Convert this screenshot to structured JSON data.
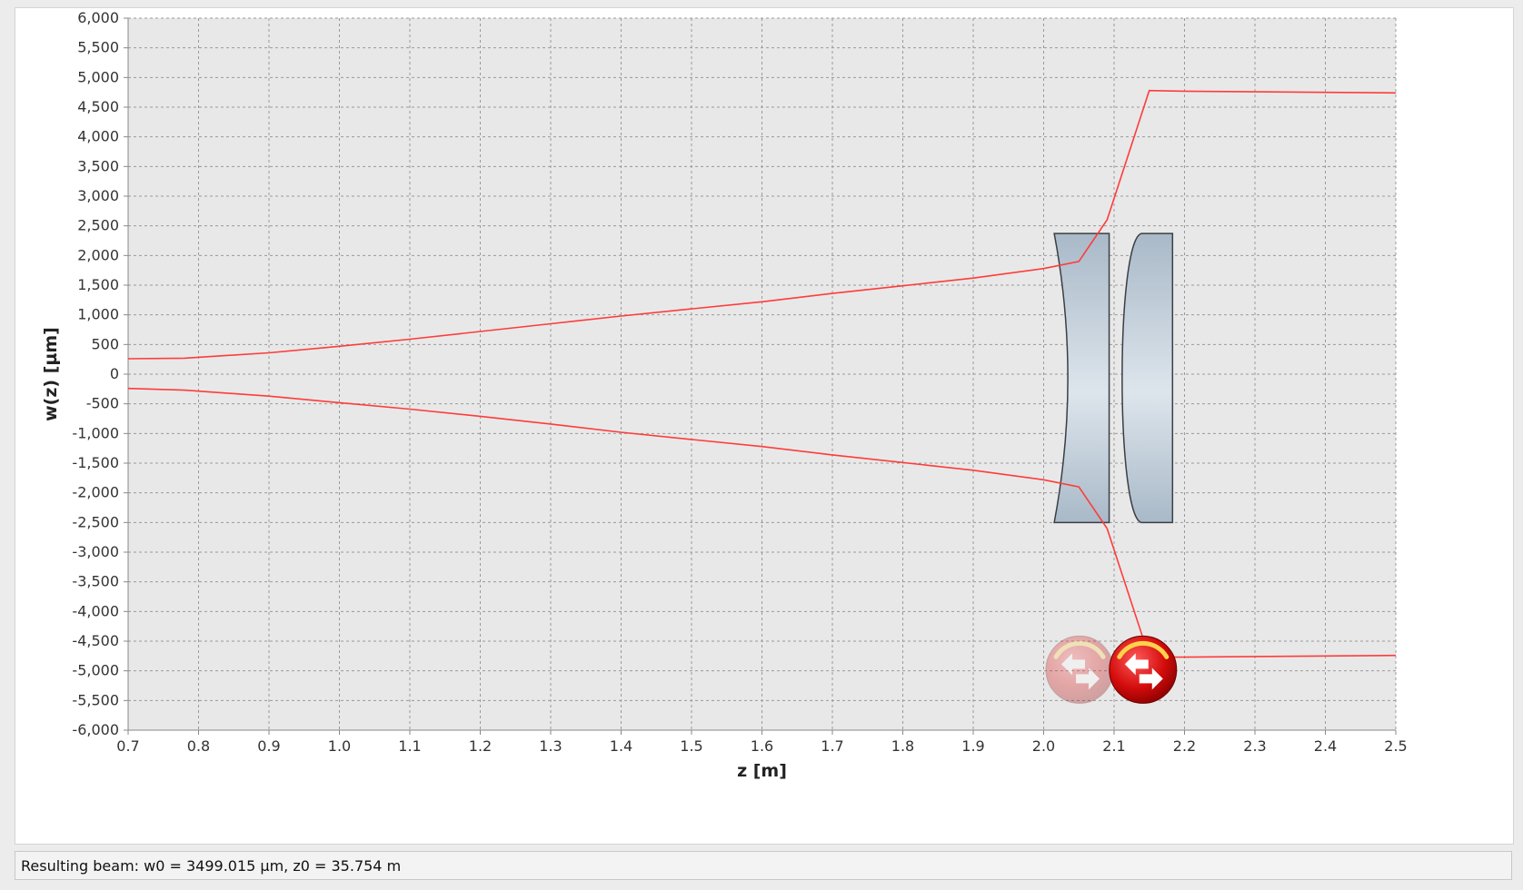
{
  "status": {
    "text": "Resulting beam: w0 = 3499.015 µm, z0 = 35.754 m"
  },
  "chart_data": {
    "type": "line",
    "title": "",
    "xlabel": "z [m]",
    "ylabel": "w(z) [µm]",
    "xlim": [
      0.7,
      2.5
    ],
    "ylim": [
      -6000,
      6000
    ],
    "xticks": [
      0.7,
      0.8,
      0.9,
      1.0,
      1.1,
      1.2,
      1.3,
      1.4,
      1.5,
      1.6,
      1.7,
      1.8,
      1.9,
      2.0,
      2.1,
      2.2,
      2.3,
      2.4,
      2.5
    ],
    "xtick_labels": [
      "0.7",
      "0.8",
      "0.9",
      "1.0",
      "1.1",
      "1.2",
      "1.3",
      "1.4",
      "1.5",
      "1.6",
      "1.7",
      "1.8",
      "1.9",
      "2.0",
      "2.1",
      "2.2",
      "2.3",
      "2.4",
      "2.5"
    ],
    "yticks": [
      6000,
      5500,
      5000,
      4500,
      4000,
      3500,
      3000,
      2500,
      2000,
      1500,
      1000,
      500,
      0,
      -500,
      -1000,
      -1500,
      -2000,
      -2500,
      -3000,
      -3500,
      -4000,
      -4500,
      -5000,
      -5500,
      -6000
    ],
    "ytick_labels": [
      "6,000",
      "5,500",
      "5,000",
      "4,500",
      "4,000",
      "3,500",
      "3,000",
      "2,500",
      "2,000",
      "1,500",
      "1,000",
      "500",
      "0",
      "-500",
      "-1,000",
      "-1,500",
      "-2,000",
      "-2,500",
      "-3,000",
      "-3,500",
      "-4,000",
      "-4,500",
      "-5,000",
      "-5,500",
      "-6,000"
    ],
    "grid": true,
    "background": "#e8e8e8",
    "line_color": "#ff3b3b",
    "series": [
      {
        "x": [
          0.7,
          0.78,
          0.9,
          1.0,
          1.1,
          1.2,
          1.3,
          1.4,
          1.5,
          1.6,
          1.7,
          1.8,
          1.9,
          2.0,
          2.05,
          2.09,
          2.15,
          2.2,
          2.5
        ],
        "y": [
          260,
          270,
          360,
          470,
          590,
          720,
          850,
          980,
          1100,
          1220,
          1360,
          1490,
          1620,
          1780,
          1900,
          2600,
          4780,
          4770,
          4740
        ]
      },
      {
        "x": [
          0.7,
          0.78,
          0.9,
          1.0,
          1.1,
          1.2,
          1.3,
          1.4,
          1.5,
          1.6,
          1.7,
          1.8,
          1.9,
          2.0,
          2.05,
          2.09,
          2.15,
          2.2,
          2.5
        ],
        "y": [
          -240,
          -270,
          -370,
          -480,
          -590,
          -710,
          -840,
          -980,
          -1100,
          -1220,
          -1360,
          -1490,
          -1620,
          -1780,
          -1900,
          -2600,
          -4770,
          -4770,
          -4740
        ]
      }
    ],
    "lenses": [
      {
        "type": "concave",
        "z_from": 2.015,
        "z_to": 2.093,
        "w_from": -2500,
        "w_to": 2370
      },
      {
        "type": "convex",
        "z_from": 2.105,
        "z_to": 2.183,
        "w_from": -2500,
        "w_to": 2370
      }
    ],
    "markers": [
      {
        "name": "swap-handle-ghost",
        "z": 2.051,
        "w": -4980,
        "opacity": 0.3
      },
      {
        "name": "swap-handle",
        "z": 2.141,
        "w": -4980,
        "opacity": 1.0
      }
    ]
  }
}
